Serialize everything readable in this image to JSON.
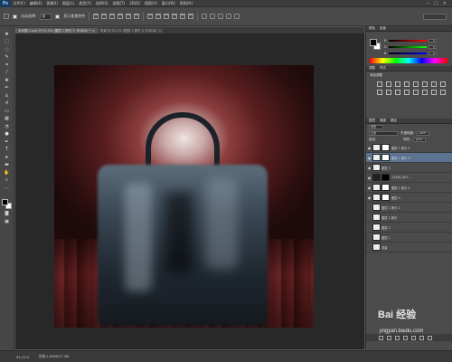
{
  "app": {
    "logo": "Ps"
  },
  "menubar": {
    "items": [
      "文件(F)",
      "编辑(E)",
      "图像(I)",
      "图层(L)",
      "类型(Y)",
      "选择(S)",
      "滤镜(T)",
      "3D(D)",
      "视图(V)",
      "窗口(W)",
      "帮助(H)"
    ],
    "window_controls": [
      "−",
      "□",
      "×"
    ]
  },
  "options_bar": {
    "auto_select_label": "自动选择:",
    "auto_select_value": "组",
    "show_transform_label": "显示变换控件"
  },
  "document_tabs": [
    {
      "label": "未标题-1.psd @ 91.2% (图层 1 拷贝 3, RGB/8) *",
      "close": "×",
      "active": true
    },
    {
      "label": "背景 @ 91.2% (图层 1 拷贝 3, RGB/8)",
      "close": "×",
      "active": false
    }
  ],
  "color_panel": {
    "tabs": [
      "颜色",
      "色板"
    ],
    "r": {
      "label": "R",
      "value": "0"
    },
    "g": {
      "label": "G",
      "value": "0"
    },
    "b": {
      "label": "B",
      "value": "0"
    }
  },
  "adjustments_panel": {
    "tabs": [
      "调整",
      "样式"
    ],
    "title": "添加调整"
  },
  "layers_panel": {
    "tabs": [
      "图层",
      "通道",
      "路径"
    ],
    "kind_filter": "类型",
    "blend_mode": "正常",
    "opacity_label": "不透明度:",
    "opacity_value": "100%",
    "lock_label": "锁定:",
    "fill_label": "填充:",
    "fill_value": "100%",
    "layers": [
      {
        "name": "图层 1 拷贝 5",
        "visible": true,
        "thumb": "light",
        "mask": "white",
        "selected": false
      },
      {
        "name": "图层 1 拷贝 3",
        "visible": true,
        "thumb": "light",
        "mask": "white",
        "selected": true
      },
      {
        "name": "图层 3",
        "visible": true,
        "thumb": "light",
        "mask": "none",
        "selected": false
      },
      {
        "name": "12345_007...",
        "visible": true,
        "thumb": "dark",
        "mask": "black",
        "selected": false
      },
      {
        "name": "图层 1 拷贝 4",
        "visible": true,
        "thumb": "light",
        "mask": "white",
        "selected": false
      },
      {
        "name": "图层 4",
        "visible": true,
        "thumb": "light",
        "mask": "white",
        "selected": false
      },
      {
        "name": "图层 1 拷贝 2",
        "visible": false,
        "thumb": "light",
        "mask": "none",
        "selected": false
      },
      {
        "name": "图层 1 拷贝",
        "visible": false,
        "thumb": "light",
        "mask": "none",
        "selected": false
      },
      {
        "name": "图层 2",
        "visible": false,
        "thumb": "light",
        "mask": "none",
        "selected": false
      },
      {
        "name": "图层 1",
        "visible": false,
        "thumb": "light",
        "mask": "none",
        "selected": false
      },
      {
        "name": "背景",
        "visible": false,
        "thumb": "light",
        "mask": "none",
        "selected": false
      }
    ]
  },
  "status_bar": {
    "zoom": "91.21%",
    "doc_info": "文档:1.65M/27.3M"
  },
  "watermark": {
    "brand": "Bai 经验",
    "url": "jingyan.baidu.com"
  },
  "colors": {
    "selected_layer": "#5b7291",
    "panel_bg": "#4b4b4b",
    "canvas_bg": "#282828"
  }
}
